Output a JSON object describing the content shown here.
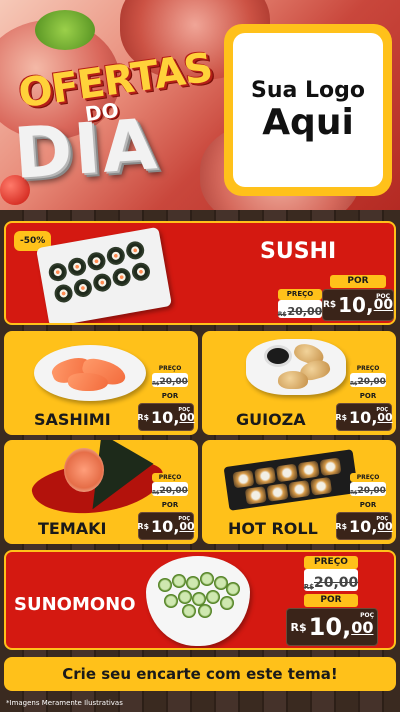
{
  "header": {
    "ofertas": "OFERTAS",
    "do": "DO",
    "dia": "DIA",
    "logo_line1": "Sua Logo",
    "logo_line2": "Aqui"
  },
  "colors": {
    "red": "#d41911",
    "yellow": "#ffc11a",
    "wood": "#3a2a20",
    "tag_dark": "#3a2419"
  },
  "products": {
    "sushi": {
      "badge": "-50%",
      "name": "SUSHI",
      "preco_label": "PREÇO",
      "old_price": "20,00",
      "old_prefix": "R$",
      "por_label": "POR",
      "currency": "R$",
      "price_int": "10",
      "price_cents": "00",
      "poc": "POÇ"
    },
    "sashimi": {
      "name": "SASHIMI",
      "preco_label": "PREÇO",
      "old_price": "20,00",
      "old_prefix": "R$",
      "por_label": "POR",
      "currency": "R$",
      "price_int": "10",
      "price_cents": "00",
      "poc": "POÇ"
    },
    "guioza": {
      "name": "GUIOZA",
      "preco_label": "PREÇO",
      "old_price": "20,00",
      "old_prefix": "R$",
      "por_label": "POR",
      "currency": "R$",
      "price_int": "10",
      "price_cents": "00",
      "poc": "POÇ"
    },
    "temaki": {
      "name": "TEMAKI",
      "preco_label": "PREÇO",
      "old_price": "20,00",
      "old_prefix": "R$",
      "por_label": "POR",
      "currency": "R$",
      "price_int": "10",
      "price_cents": "00",
      "poc": "POÇ"
    },
    "hotroll": {
      "name": "HOT ROLL",
      "preco_label": "PREÇO",
      "old_price": "20,00",
      "old_prefix": "R$",
      "por_label": "POR",
      "currency": "R$",
      "price_int": "10",
      "price_cents": "00",
      "poc": "POÇ"
    },
    "sunomono": {
      "name": "SUNOMONO",
      "preco_label": "PREÇO",
      "old_price": "20,00",
      "old_prefix": "R$",
      "por_label": "POR",
      "currency": "R$",
      "price_int": "10",
      "price_cents": "00",
      "poc": "POÇ"
    }
  },
  "footer": {
    "cta": "Crie seu encarte com este tema!",
    "disclaimer": "*Imagens Meramente Ilustrativas"
  }
}
